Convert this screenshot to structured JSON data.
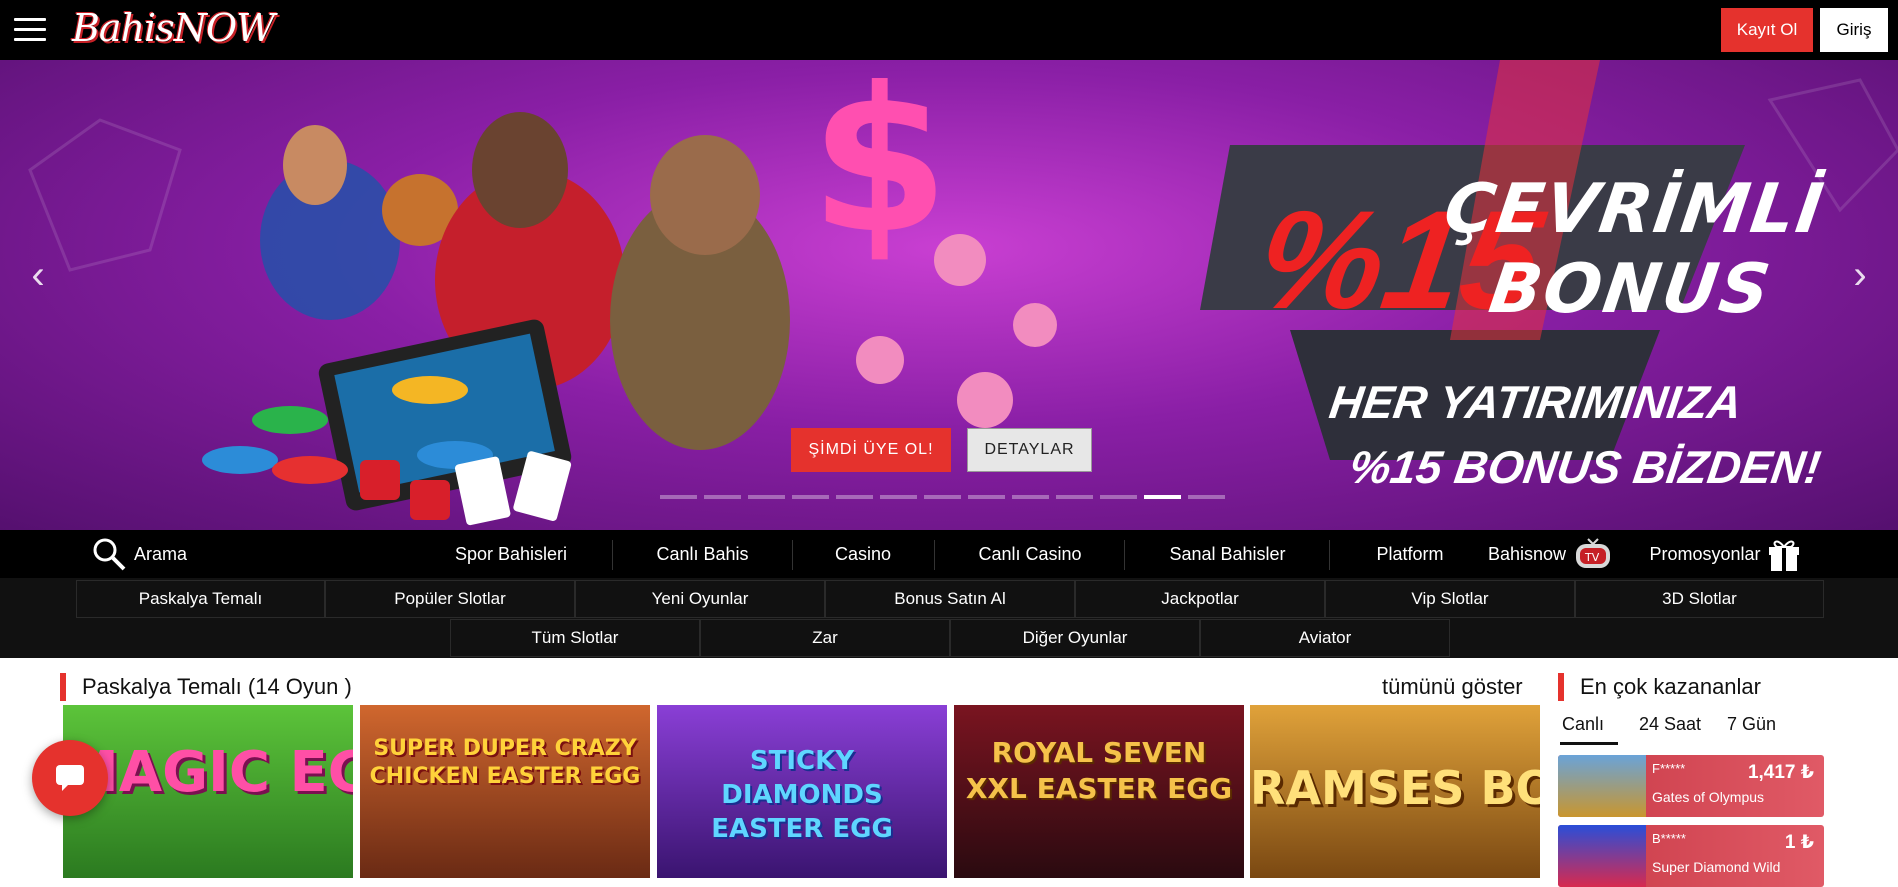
{
  "header": {
    "logo_text": "BahisNOW",
    "register_label": "Kayıt Ol",
    "login_label": "Giriş"
  },
  "hero": {
    "promo": {
      "percent": "%15",
      "line1": "ÇEVRİMLİ",
      "line1b": "BONUS",
      "line2": "HER YATIRIMINIZA",
      "line3": "%15 BONUS BİZDEN!"
    },
    "cta_primary": "ŞİMDİ ÜYE OL!",
    "cta_secondary": "DETAYLAR",
    "slide_count": 13,
    "active_slide": 11
  },
  "main_nav": {
    "search_label": "Arama",
    "items": [
      "Spor Bahisleri",
      "Canlı Bahis",
      "Casino",
      "Canlı Casino",
      "Sanal Bahisler",
      "Platform",
      "Bahisnow",
      "Promosyonlar"
    ]
  },
  "sub_nav": {
    "row1": [
      "Paskalya Temalı",
      "Popüler Slotlar",
      "Yeni Oyunlar",
      "Bonus Satın Al",
      "Jackpotlar",
      "Vip Slotlar",
      "3D Slotlar"
    ],
    "row2": [
      "Tüm Slotlar",
      "Zar",
      "Diğer Oyunlar",
      "Aviator"
    ]
  },
  "games_section": {
    "title": "Paskalya Temalı (14 Oyun )",
    "show_all": "tümünü göster",
    "games": [
      {
        "title": "MAGIC EGGS",
        "color": "#3aa63a"
      },
      {
        "title": "SUPER DUPER CRAZY CHICKEN EASTER EGG",
        "color": "#b4472a"
      },
      {
        "title": "STICKY DIAMONDS EASTER EGG",
        "color": "#6a2fb0"
      },
      {
        "title": "ROYAL SEVEN XXL EASTER EGG",
        "color": "#7a1420"
      },
      {
        "title": "RAMSES BOOK",
        "color": "#c8861d"
      }
    ]
  },
  "winners": {
    "title": "En çok kazananlar",
    "tabs": [
      "Canlı",
      "24 Saat",
      "7 Gün"
    ],
    "active_tab": 0,
    "items": [
      {
        "user": "F*****",
        "amount": "1,417 ₺",
        "game": "Gates of Olympus"
      },
      {
        "user": "B*****",
        "amount": "1 ₺",
        "game": "Super Diamond Wild"
      }
    ]
  },
  "colors": {
    "accent": "#e5322d",
    "header_bg": "#000000",
    "hero_purple": "#8a1fa6"
  }
}
